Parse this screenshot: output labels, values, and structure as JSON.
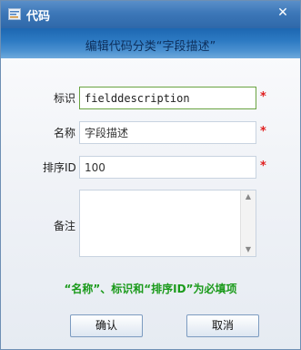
{
  "window": {
    "title": "代码",
    "close_symbol": "✕"
  },
  "header": {
    "text": "编辑代码分类“字段描述”"
  },
  "form": {
    "id_label": "标识",
    "id_value": "fielddescription",
    "name_label": "名称",
    "name_value": "字段描述",
    "order_label": "排序ID",
    "order_value": "100",
    "remark_label": "备注",
    "remark_value": "",
    "required_mark": "*"
  },
  "hint": "“名称”、标识和“排序ID”为必填项",
  "buttons": {
    "confirm": "确认",
    "cancel": "取消"
  },
  "colors": {
    "title_bar": "#3c77b8",
    "header_banner": "#2c79c2",
    "required": "#e02020",
    "hint": "#1a9a1a",
    "active_border": "#6aa442"
  },
  "icons": {
    "app": "code-app-icon",
    "close": "close-icon",
    "scroll_up": "scroll-up-arrow-icon",
    "scroll_down": "scroll-down-arrow-icon"
  }
}
